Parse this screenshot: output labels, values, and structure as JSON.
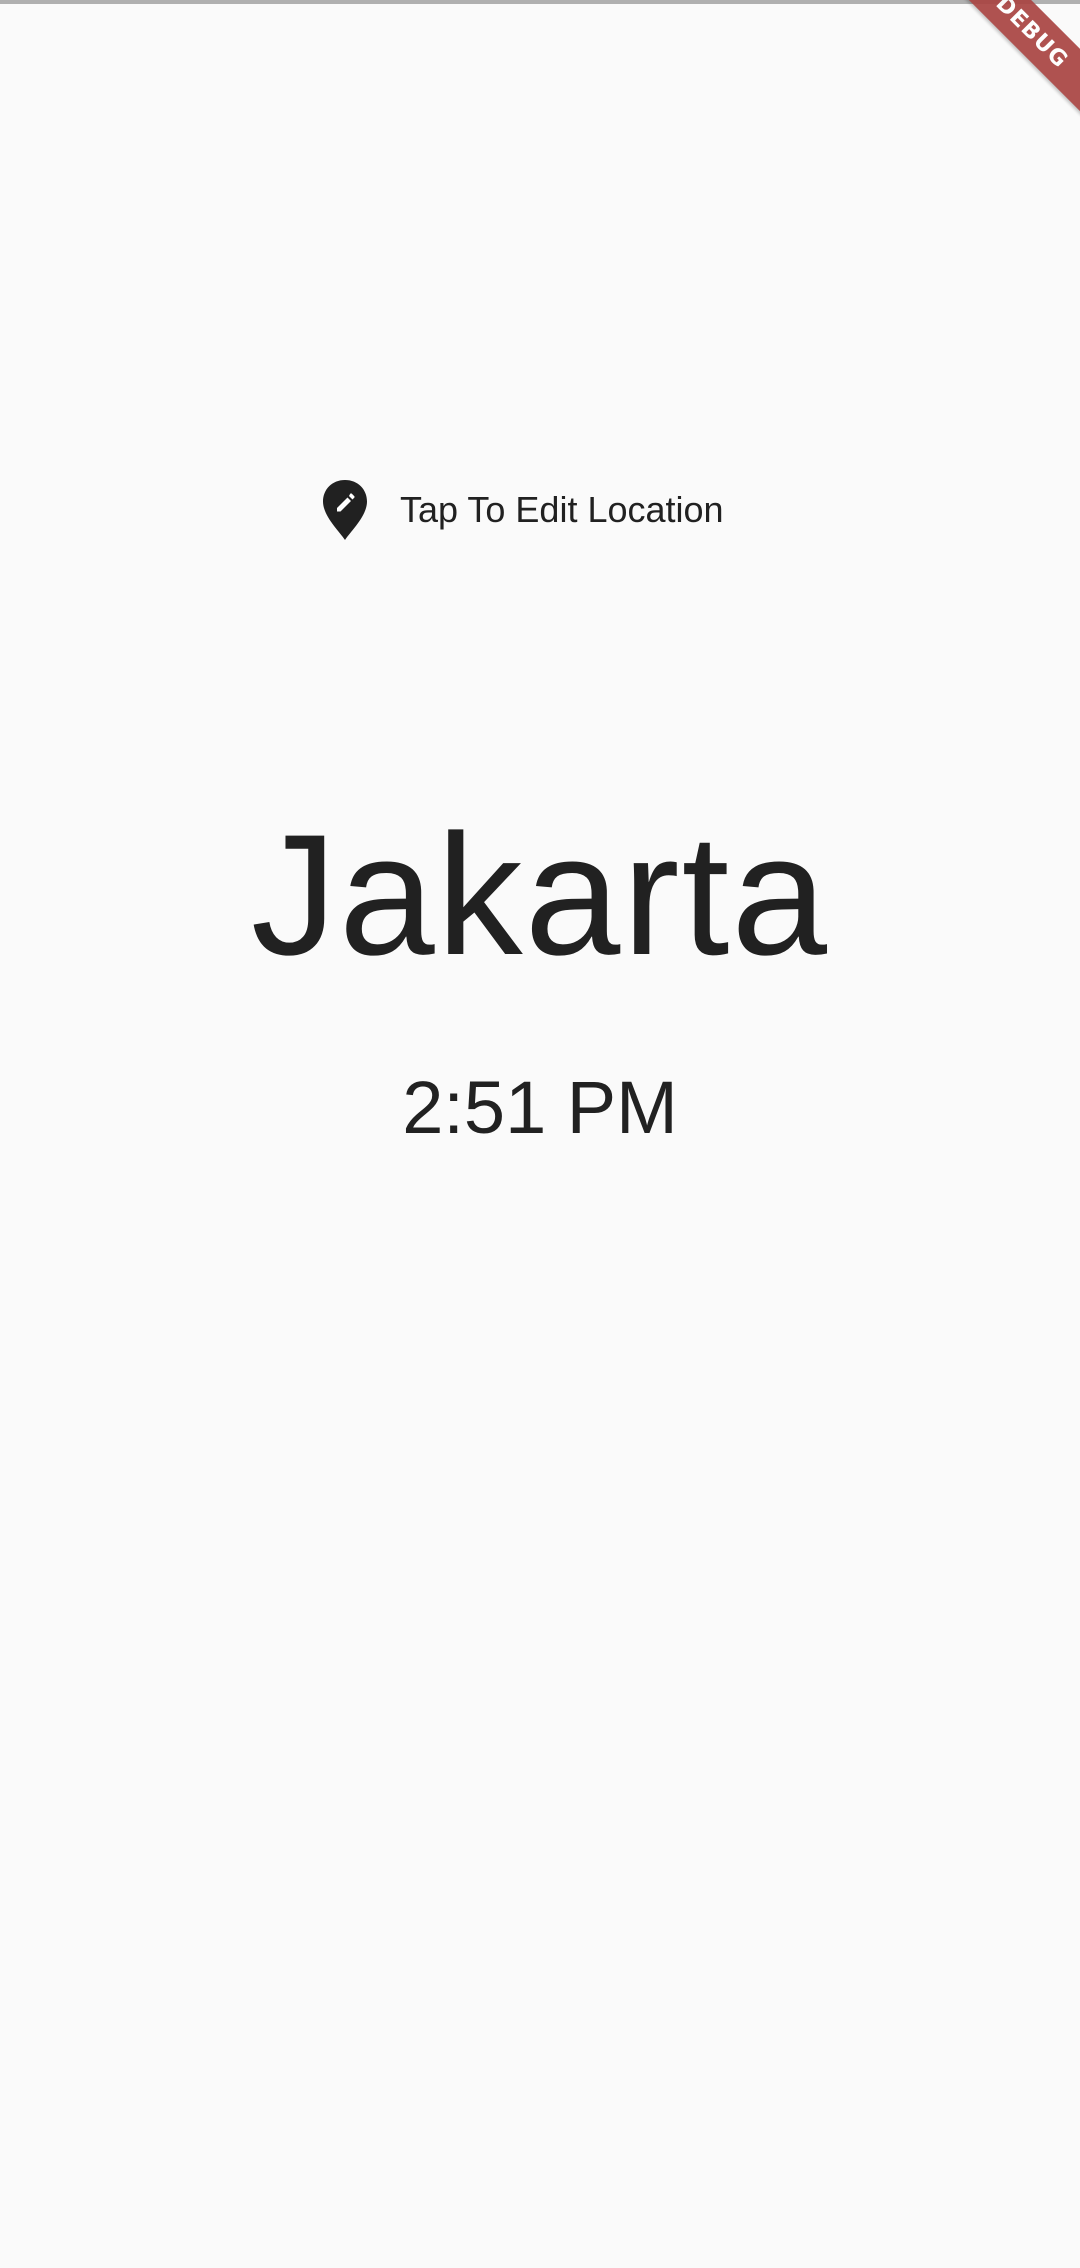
{
  "header": {
    "debug_banner_label": "DEBUG",
    "debug_banner_color": "#a94442"
  },
  "location": {
    "icon": "edit-location-icon",
    "edit_label": "Tap To Edit Location"
  },
  "main": {
    "city": "Jakarta",
    "time": "2:51 PM"
  },
  "colors": {
    "background": "#fafafa",
    "text": "#212121"
  }
}
